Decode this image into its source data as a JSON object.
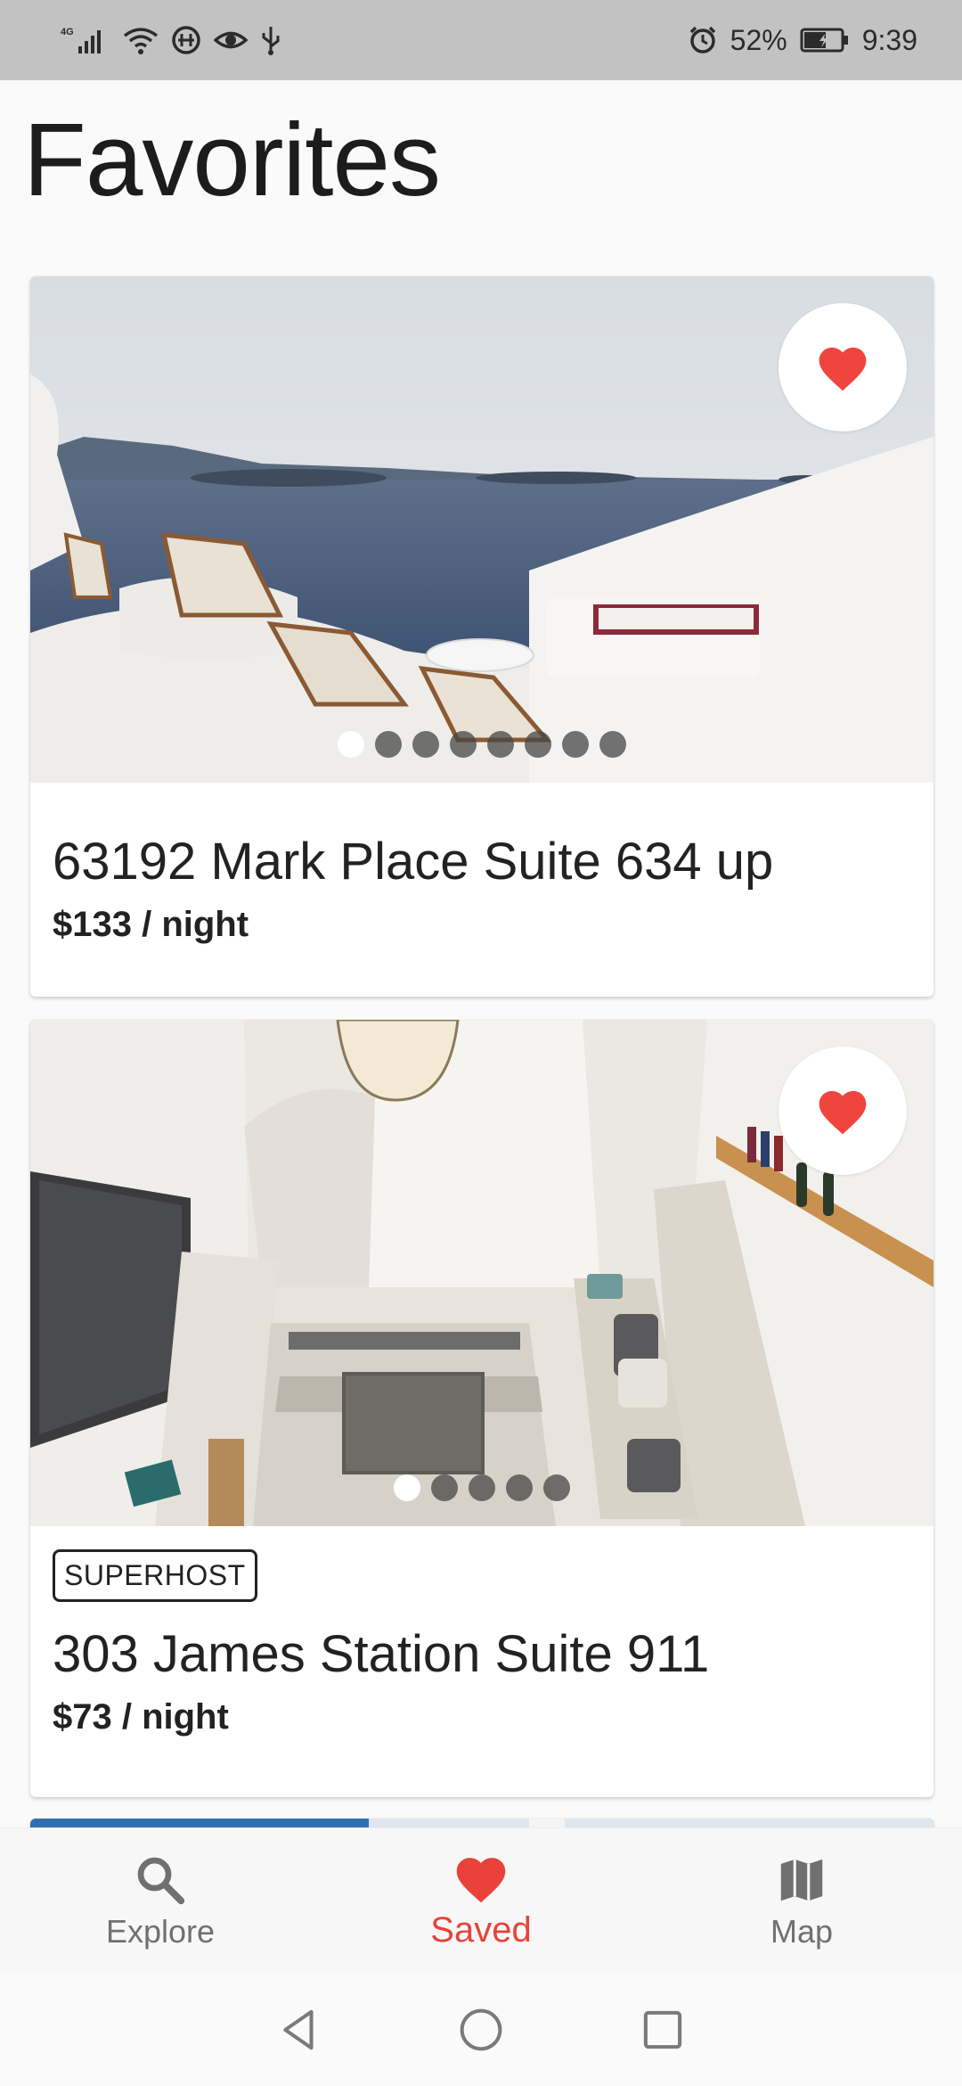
{
  "status_bar": {
    "network": "4G",
    "battery": "52%",
    "time": "9:39",
    "icons": [
      "signal-icon",
      "wifi-icon",
      "data-saver-icon",
      "eye-icon",
      "usb-icon",
      "alarm-icon",
      "battery-icon"
    ]
  },
  "page": {
    "title": "Favorites"
  },
  "listings": [
    {
      "name": "63192 Mark Place Suite 634 up",
      "price": "$133 / night",
      "badge": "",
      "photo_count": 8,
      "active_photo": 1,
      "favorited": true
    },
    {
      "name": "303 James Station Suite 911",
      "price": "$73 / night",
      "badge": "SUPERHOST",
      "photo_count": 5,
      "active_photo": 1,
      "favorited": true
    }
  ],
  "bottom_nav": {
    "items": [
      {
        "label": "Explore",
        "icon": "search-icon"
      },
      {
        "label": "Saved",
        "icon": "heart-icon",
        "active": true
      },
      {
        "label": "Map",
        "icon": "map-icon"
      }
    ]
  },
  "colors": {
    "accent": "#e8423b",
    "heart": "#f0453f"
  }
}
